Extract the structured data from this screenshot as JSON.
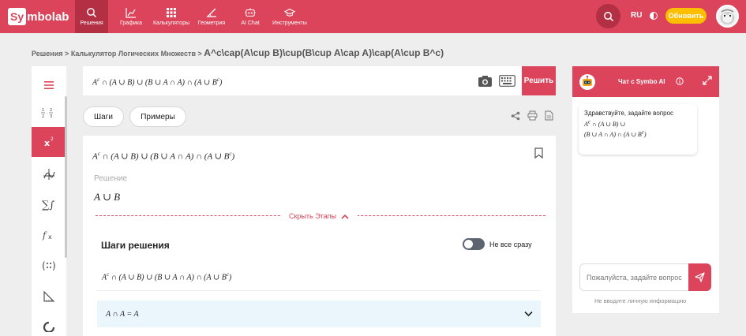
{
  "nav": {
    "logo_box": "Sy",
    "logo_rest": "mbolab",
    "items": [
      {
        "label": "Решения",
        "icon": "magnifier-icon"
      },
      {
        "label": "Графика",
        "icon": "line-chart-icon"
      },
      {
        "label": "Калькуляторы",
        "icon": "calculator-grid-icon"
      },
      {
        "label": "Геометрия",
        "icon": "angle-icon"
      },
      {
        "label": "AI Chat",
        "icon": "robot-icon"
      },
      {
        "label": "Инструменты",
        "icon": "graduation-cap-icon"
      }
    ],
    "lang": "RU",
    "upgrade_label": "Обновить"
  },
  "breadcrumb": {
    "root": "Решения",
    "sep": ">",
    "calc": "Калькулятор Логических Множеств",
    "current": "A^c\\cap(A\\cup B)\\cup(B\\cup A\\cap A)\\cap(A\\cup B^c)"
  },
  "input": {
    "solve_label": "Решить"
  },
  "tabs": {
    "steps_label": "Шаги",
    "examples_label": "Примеры"
  },
  "solution": {
    "answer_label": "Решение",
    "answer": "A ∪ B",
    "hide_steps_label": "Скрыть Этапы",
    "steps_title": "Шаги решения",
    "toggle_label": "Не все сразу",
    "step_1": "A ∩ A = A"
  },
  "chat": {
    "title": "Чат с Symbo AI",
    "greeting": "Здравствуйте, задайте вопрос",
    "input_placeholder": "Пожалуйста, задайте вопрос",
    "disclaimer": "Не вводите личную информацию"
  },
  "colors": {
    "brand": "#db445a",
    "brand_dark": "#b32f43",
    "upgrade": "#fdbe00",
    "step_bg": "#eaf6fb"
  }
}
